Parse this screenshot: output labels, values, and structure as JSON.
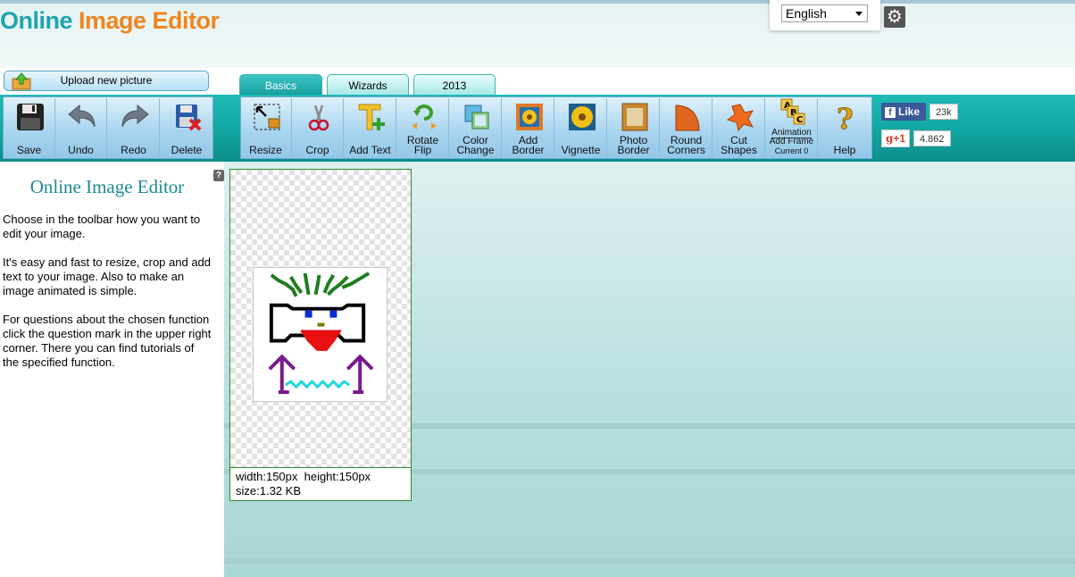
{
  "app": {
    "logo_word1": "Online",
    "logo_word2": "Image Editor",
    "language": "English"
  },
  "upload": {
    "label": "Upload new picture"
  },
  "tabs": [
    {
      "label": "Basics",
      "active": true
    },
    {
      "label": "Wizards",
      "active": false
    },
    {
      "label": "2013",
      "active": false
    }
  ],
  "toolbar": {
    "file_tools": [
      {
        "label": "Save",
        "icon": "floppy-disk-icon"
      },
      {
        "label": "Undo",
        "icon": "undo-arrow-icon"
      },
      {
        "label": "Redo",
        "icon": "redo-arrow-icon"
      },
      {
        "label": "Delete",
        "icon": "delete-icon"
      }
    ],
    "edit_tools": [
      {
        "line1": "",
        "line2": "Resize",
        "icon": "resize-icon"
      },
      {
        "line1": "",
        "line2": "Crop",
        "icon": "scissors-icon"
      },
      {
        "line1": "",
        "line2": "Add Text",
        "icon": "add-text-icon"
      },
      {
        "line1": "Rotate",
        "line2": "Flip",
        "icon": "rotate-icon"
      },
      {
        "line1": "Color",
        "line2": "Change",
        "icon": "color-change-icon"
      },
      {
        "line1": "Add",
        "line2": "Border",
        "icon": "border-icon"
      },
      {
        "line1": "",
        "line2": "Vignette",
        "icon": "vignette-icon"
      },
      {
        "line1": "Photo",
        "line2": "Border",
        "icon": "photo-border-icon"
      },
      {
        "line1": "Round",
        "line2": "Corners",
        "icon": "round-corners-icon"
      },
      {
        "line1": "Cut",
        "line2": "Shapes",
        "icon": "cut-shapes-icon"
      },
      {
        "line1": "",
        "line2": "",
        "icon": "animation-icon"
      },
      {
        "line1": "",
        "line2": "Help",
        "icon": "help-icon"
      }
    ],
    "animation": {
      "title": "Animation",
      "sub1": "Add Frame",
      "sub2": "Current 0"
    }
  },
  "social": {
    "fb_label": "Like",
    "fb_count": "23k",
    "gplus_label": "+1",
    "gplus_count": "4.862"
  },
  "panel": {
    "title": "Online Image Editor",
    "help_mark": "?",
    "p1": "Choose in the toolbar how you want to edit your image.",
    "p2": "It's easy and fast to resize, crop and add text to your image. Also to make an image animated is simple.",
    "p3": "For questions about the chosen function click the question mark in the upper right corner. There you can find tutorials of the specified function."
  },
  "image_info": {
    "dimensions": "width:150px  height:150px",
    "size": "size:1.32 KB"
  },
  "colors": {
    "toolbar_teal": "#13a8a4",
    "logo_teal": "#1ea5b0",
    "logo_orange": "#f0861f",
    "panel_title": "#1a8b92"
  }
}
